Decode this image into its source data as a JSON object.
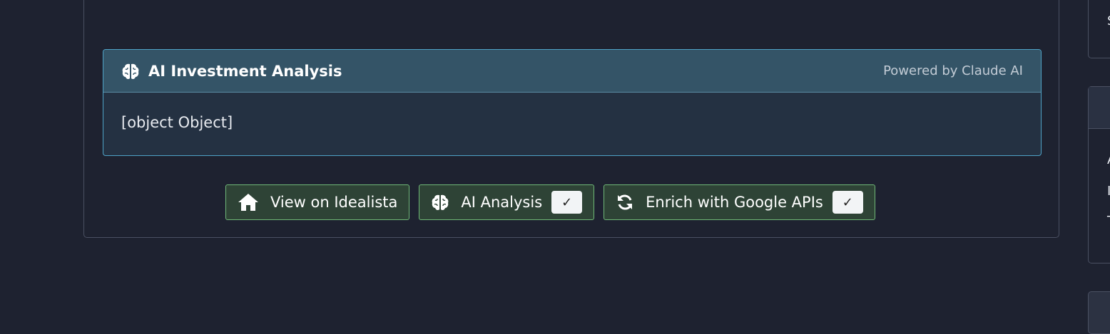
{
  "ai_panel": {
    "title": "AI Investment Analysis",
    "powered_by": "Powered by Claude AI",
    "body": "[object Object]"
  },
  "actions": {
    "view_label": "View on Idealista",
    "ai_label": "AI Analysis",
    "ai_check": "✓",
    "enrich_label": "Enrich with Google APIs",
    "enrich_check": "✓"
  },
  "icons": {
    "brain": "brain-icon",
    "home": "home-icon",
    "refresh": "refresh-icon"
  },
  "colors": {
    "accent_blue": "#4fa3c7",
    "button_green_border": "#6fb877",
    "background": "#1e2230"
  },
  "sidebar": {
    "top_char": "S",
    "mid_chars": [
      "A",
      "I",
      "T"
    ]
  }
}
